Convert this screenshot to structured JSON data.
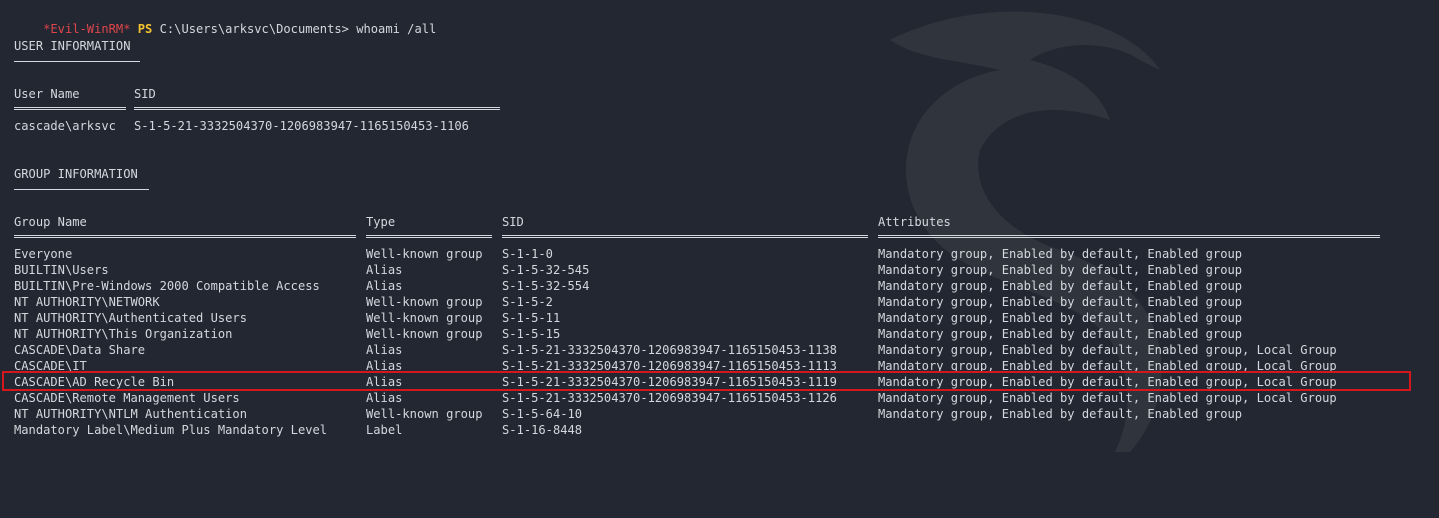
{
  "prompt": {
    "evil": "*Evil-WinRM*",
    "ps": "PS",
    "path": "C:\\Users\\arksvc\\Documents>",
    "command": "whoami /all"
  },
  "user_info": {
    "title": "USER INFORMATION",
    "headers": {
      "user_name": "User Name",
      "sid": "SID"
    },
    "row": {
      "user_name": "cascade\\arksvc",
      "sid": "S-1-5-21-3332504370-1206983947-1165150453-1106"
    }
  },
  "group_info": {
    "title": "GROUP INFORMATION",
    "headers": {
      "group_name": "Group Name",
      "type": "Type",
      "sid": "SID",
      "attributes": "Attributes"
    },
    "rows": [
      {
        "name": "Everyone",
        "type": "Well-known group",
        "sid": "S-1-1-0",
        "attributes": "Mandatory group, Enabled by default, Enabled group"
      },
      {
        "name": "BUILTIN\\Users",
        "type": "Alias",
        "sid": "S-1-5-32-545",
        "attributes": "Mandatory group, Enabled by default, Enabled group"
      },
      {
        "name": "BUILTIN\\Pre-Windows 2000 Compatible Access",
        "type": "Alias",
        "sid": "S-1-5-32-554",
        "attributes": "Mandatory group, Enabled by default, Enabled group"
      },
      {
        "name": "NT AUTHORITY\\NETWORK",
        "type": "Well-known group",
        "sid": "S-1-5-2",
        "attributes": "Mandatory group, Enabled by default, Enabled group"
      },
      {
        "name": "NT AUTHORITY\\Authenticated Users",
        "type": "Well-known group",
        "sid": "S-1-5-11",
        "attributes": "Mandatory group, Enabled by default, Enabled group"
      },
      {
        "name": "NT AUTHORITY\\This Organization",
        "type": "Well-known group",
        "sid": "S-1-5-15",
        "attributes": "Mandatory group, Enabled by default, Enabled group"
      },
      {
        "name": "CASCADE\\Data Share",
        "type": "Alias",
        "sid": "S-1-5-21-3332504370-1206983947-1165150453-1138",
        "attributes": "Mandatory group, Enabled by default, Enabled group, Local Group"
      },
      {
        "name": "CASCADE\\IT",
        "type": "Alias",
        "sid": "S-1-5-21-3332504370-1206983947-1165150453-1113",
        "attributes": "Mandatory group, Enabled by default, Enabled group, Local Group"
      },
      {
        "name": "CASCADE\\AD Recycle Bin",
        "type": "Alias",
        "sid": "S-1-5-21-3332504370-1206983947-1165150453-1119",
        "attributes": "Mandatory group, Enabled by default, Enabled group, Local Group"
      },
      {
        "name": "CASCADE\\Remote Management Users",
        "type": "Alias",
        "sid": "S-1-5-21-3332504370-1206983947-1165150453-1126",
        "attributes": "Mandatory group, Enabled by default, Enabled group, Local Group"
      },
      {
        "name": "NT AUTHORITY\\NTLM Authentication",
        "type": "Well-known group",
        "sid": "S-1-5-64-10",
        "attributes": "Mandatory group, Enabled by default, Enabled group"
      },
      {
        "name": "Mandatory Label\\Medium Plus Mandatory Level",
        "type": "Label",
        "sid": "S-1-16-8448",
        "attributes": ""
      }
    ]
  },
  "colors": {
    "background": "#232731",
    "text": "#d4d7dd",
    "prompt_evil": "#e0454d",
    "prompt_ps": "#f4c430",
    "highlight": "#d4171c"
  }
}
